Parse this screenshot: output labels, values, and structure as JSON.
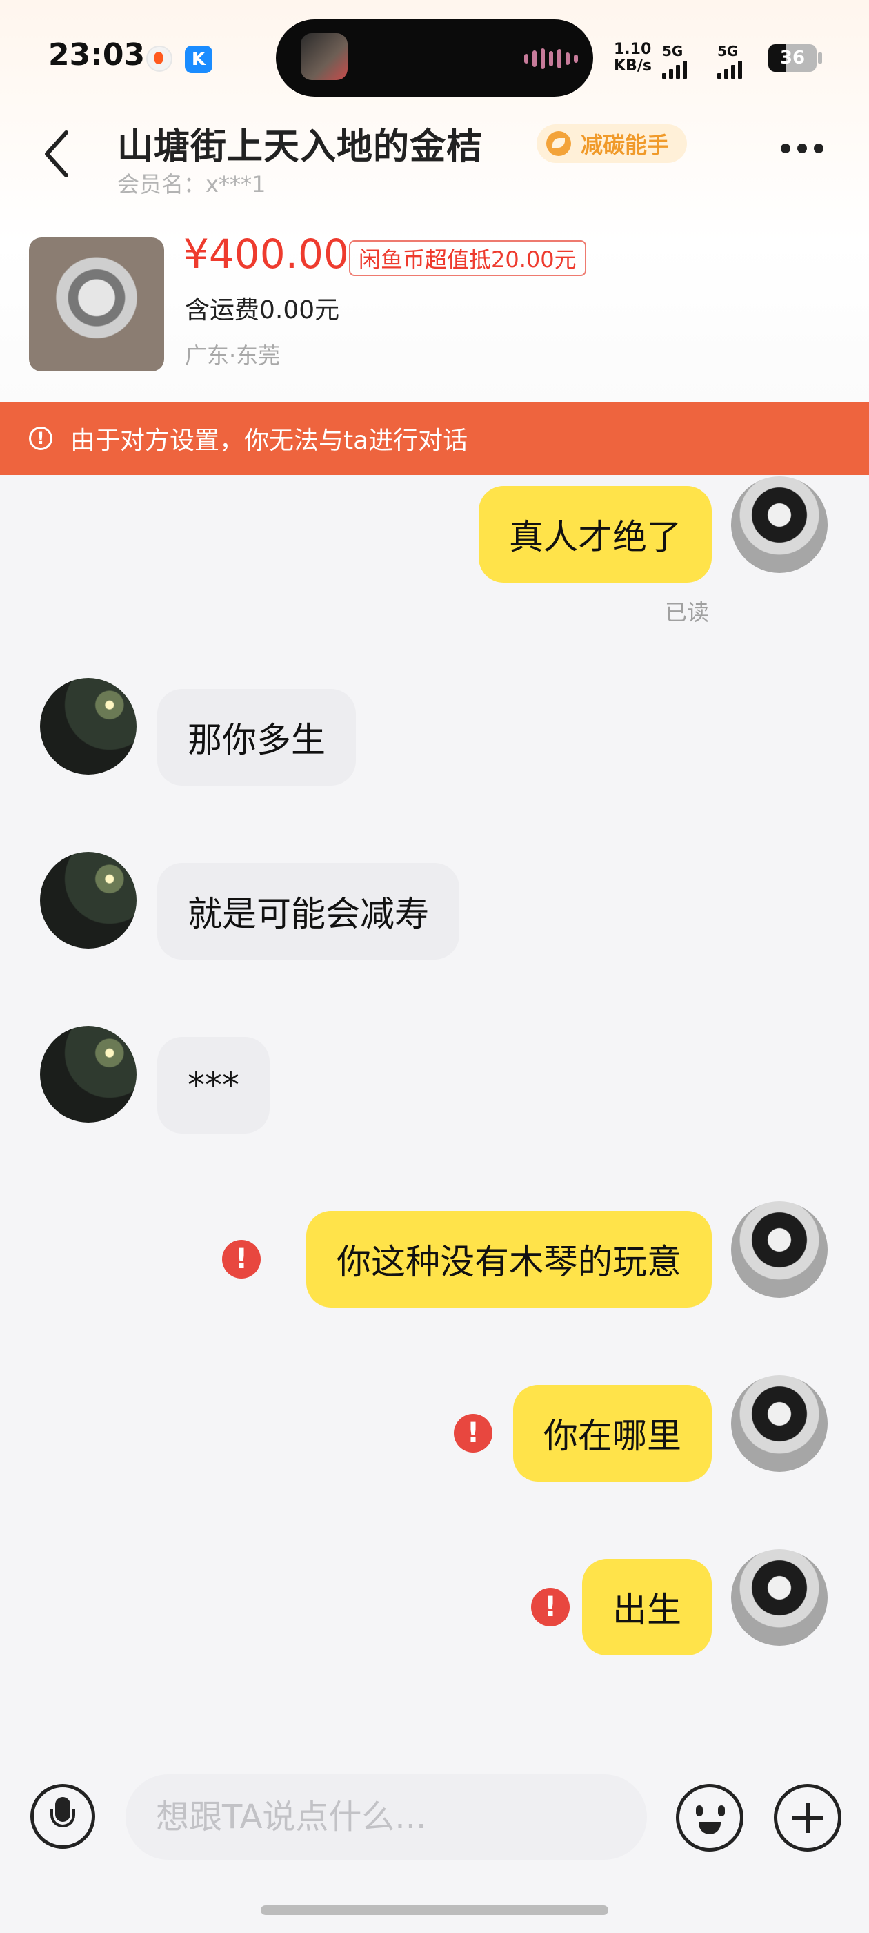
{
  "status_bar": {
    "time": "23:03",
    "icon_left": "weibo-icon",
    "icon_app": "K",
    "net_speed_value": "1.10",
    "net_speed_unit": "KB/s",
    "signal1_label": "5G",
    "signal2_label": "5G",
    "battery": "36"
  },
  "header": {
    "back_icon": "chevron-left-icon",
    "title": "山塘街上天入地的金桔",
    "badge_label": "减碳能手",
    "member": "会员名：x***1",
    "more_icon": "more-horizontal-icon"
  },
  "product": {
    "price": "¥400.00",
    "coupon": "闲鱼币超值抵20.00元",
    "shipping": "含运费0.00元",
    "location": "广东·东莞"
  },
  "notice": {
    "icon": "exclamation-circle-icon",
    "text": "由于对方设置，你无法与ta进行对话"
  },
  "messages": [
    {
      "text": "真人才绝了",
      "from": "me",
      "status": "已读"
    },
    {
      "text": "那你多生",
      "from": "them"
    },
    {
      "text": "就是可能会减寿",
      "from": "them"
    },
    {
      "text": "***",
      "from": "them"
    },
    {
      "text": "你这种没有木琴的玩意",
      "from": "me",
      "failed": true
    },
    {
      "text": "你在哪里",
      "from": "me",
      "failed": true
    },
    {
      "text": "出生",
      "from": "me",
      "failed": true
    }
  ],
  "input_bar": {
    "placeholder": "想跟TA说点什么...",
    "mic_icon": "microphone-icon",
    "emoji_icon": "emoji-icon",
    "plus_icon": "plus-icon"
  },
  "colors": {
    "accent_yellow": "#ffe34a",
    "notice_orange": "#ee643e",
    "price_red": "#ee3b2e",
    "error_red": "#e8473f"
  }
}
